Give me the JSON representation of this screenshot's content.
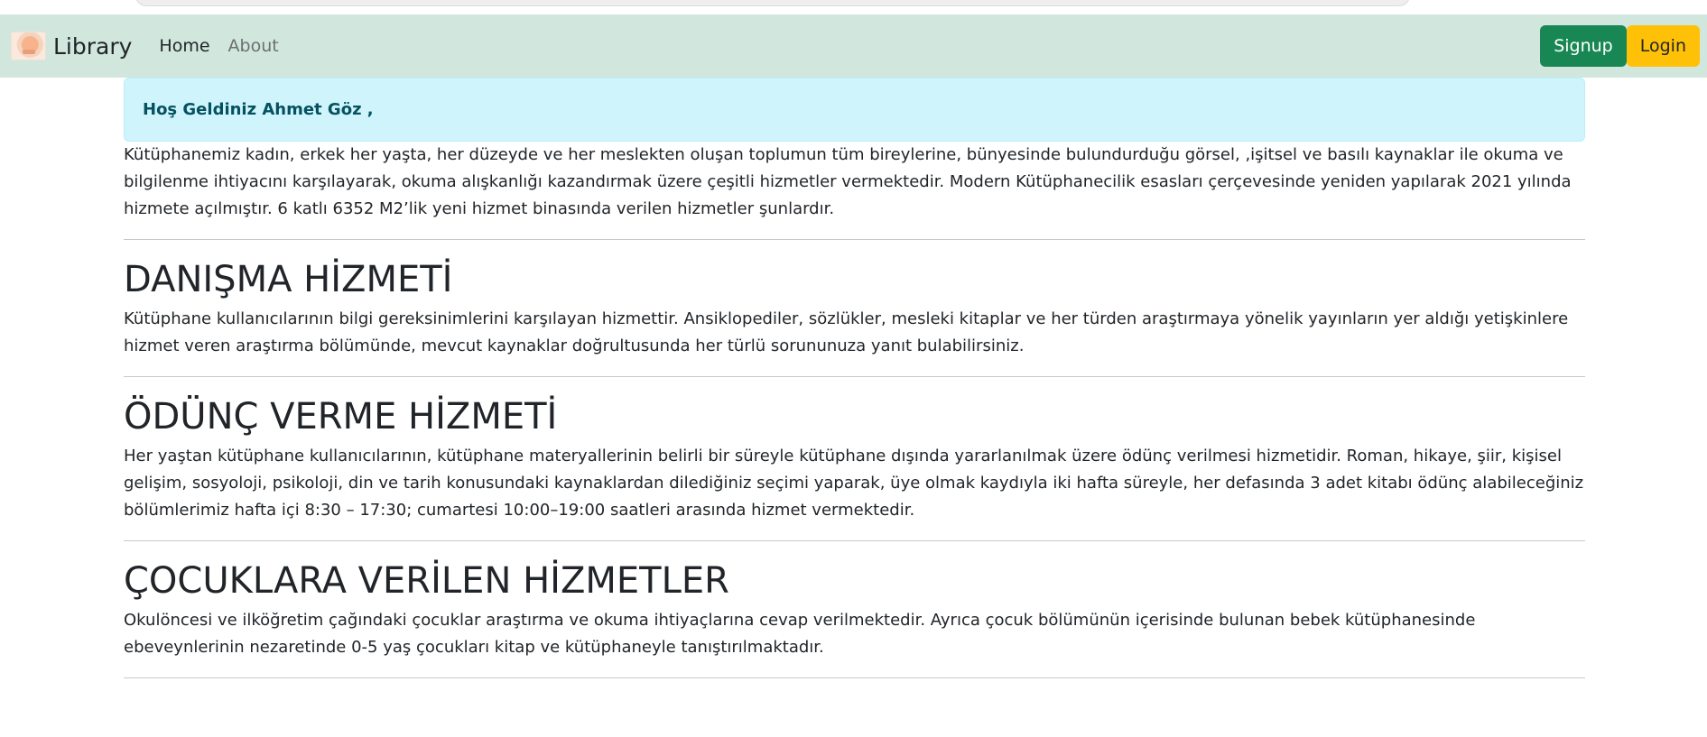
{
  "navbar": {
    "brand": "Library",
    "links": [
      "Home",
      "About"
    ],
    "signup_label": "Signup",
    "login_label": "Login",
    "bg_color": "#d1e7dd"
  },
  "welcome": {
    "text": "Hoş Geldiniz Ahmet Göz ,"
  },
  "intro": "Kütüphanemiz kadın, erkek her yaşta, her düzeyde ve her meslekten oluşan toplumun tüm bireylerine, bünyesinde bulundurduğu görsel, ,işitsel ve basılı kaynaklar ile okuma ve bilgilenme ihtiyacını karşılayarak, okuma alışkanlığı kazandırmak üzere çeşitli hizmetler vermektedir. Modern Kütüphanecilik esasları çerçevesinde yeniden yapılarak 2021 yılında hizmete açılmıştır. 6 katlı 6352 M2’lik yeni hizmet binasında verilen hizmetler şunlardır.",
  "sections": [
    {
      "title": "DANIŞMA HİZMETİ",
      "text": "Kütüphane kullanıcılarının bilgi gereksinimlerini karşılayan hizmettir. Ansiklopediler, sözlükler, mesleki kitaplar ve her türden araştırmaya yönelik yayınların yer aldığı yetişkinlere hizmet veren araştırma bölümünde, mevcut kaynaklar doğrultusunda her türlü sorununuza yanıt bulabilirsiniz."
    },
    {
      "title": "ÖDÜNÇ VERME HİZMETİ",
      "text": "Her yaştan kütüphane kullanıcılarının, kütüphane materyallerinin belirli bir süreyle kütüphane dışında yararlanılmak üzere ödünç verilmesi hizmetidir. Roman, hikaye, şiir, kişisel gelişim, sosyoloji, psikoloji, din ve tarih konusundaki kaynaklardan dilediğiniz seçimi yaparak, üye olmak kaydıyla iki hafta süreyle, her defasında 3 adet kitabı ödünç alabileceğiniz bölümlerimiz hafta içi 8:30 – 17:30; cumartesi 10:00–19:00 saatleri arasında hizmet vermektedir."
    },
    {
      "title": "ÇOCUKLARA VERİLEN HİZMETLER",
      "text": "Okulöncesi ve ilköğretim çağındaki çocuklar araştırma ve okuma ihtiyaçlarına cevap verilmektedir. Ayrıca çocuk bölümünün içerisinde bulunan bebek kütüphanesinde ebeveynlerinin nezaretinde 0-5 yaş çocukları kitap ve kütüphaneyle tanıştırılmaktadır."
    }
  ]
}
